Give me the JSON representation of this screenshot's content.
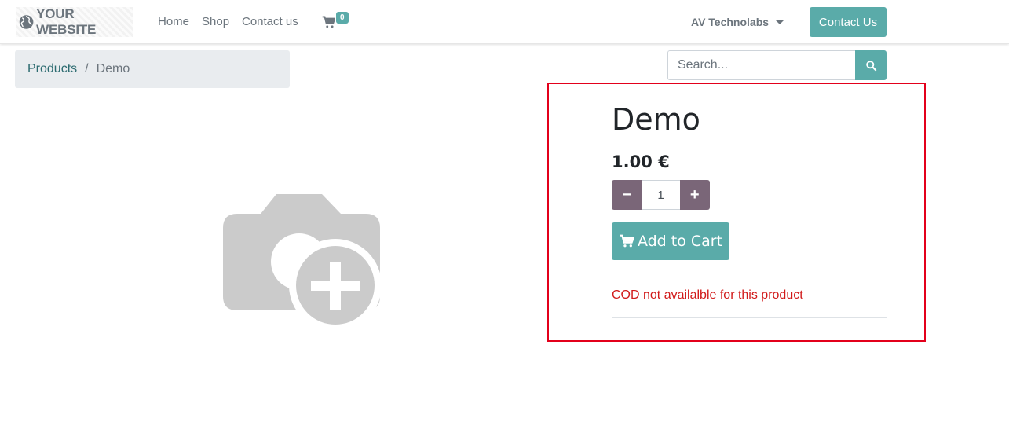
{
  "header": {
    "brand_text": "YOUR WEBSITE",
    "nav": [
      "Home",
      "Shop",
      "Contact us"
    ],
    "cart_count": "0",
    "account_name": "AV Technolabs",
    "contact_button": "Contact Us"
  },
  "breadcrumb": {
    "parent": "Products",
    "separator": "/",
    "current": "Demo"
  },
  "search": {
    "placeholder": "Search..."
  },
  "product": {
    "title": "Demo",
    "price": "1.00 €",
    "quantity": "1",
    "minus_symbol": "−",
    "plus_symbol": "+",
    "add_to_cart_label": "Add to Cart",
    "cod_note": "COD not availalble for this product"
  },
  "colors": {
    "primary": "#5aaba9",
    "secondary": "#7a6678",
    "highlight_border": "#e3001b",
    "warning_text": "#d11a1a"
  },
  "icons": {
    "brand": "globe-icon",
    "cart": "shopping-cart-icon",
    "search": "search-icon",
    "product_placeholder": "camera-add-icon"
  }
}
